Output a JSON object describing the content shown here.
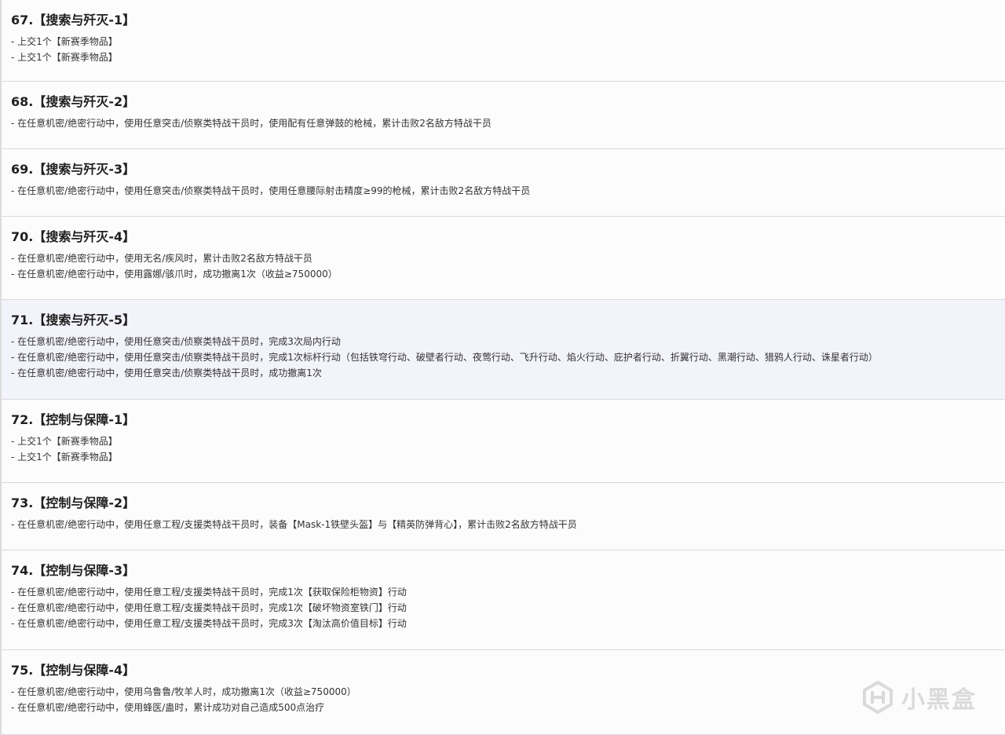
{
  "tasks": [
    {
      "title": "67.【搜索与歼灭-1】",
      "lines": [
        "- 上交1个【新赛季物品】",
        "- 上交1个【新赛季物品】"
      ]
    },
    {
      "title": "68.【搜索与歼灭-2】",
      "lines": [
        "- 在任意机密/绝密行动中，使用任意突击/侦察类特战干员时，使用配有任意弹鼓的枪械，累计击败2名敌方特战干员"
      ]
    },
    {
      "title": "69.【搜索与歼灭-3】",
      "lines": [
        "- 在任意机密/绝密行动中，使用任意突击/侦察类特战干员时，使用任意腰际射击精度≥99的枪械，累计击败2名敌方特战干员"
      ]
    },
    {
      "title": "70.【搜索与歼灭-4】",
      "lines": [
        "- 在任意机密/绝密行动中，使用无名/疾风时，累计击败2名敌方特战干员",
        "- 在任意机密/绝密行动中，使用露娜/骇爪时，成功撤离1次（收益≥750000）"
      ]
    },
    {
      "title": "71.【搜索与歼灭-5】",
      "highlight": true,
      "lines": [
        "- 在任意机密/绝密行动中，使用任意突击/侦察类特战干员时，完成3次局内行动",
        "- 在任意机密/绝密行动中，使用任意突击/侦察类特战干员时，完成1次标杆行动（包括铁穹行动、破壁者行动、夜莺行动、飞升行动、焰火行动、庇护者行动、折翼行动、黑潮行动、猎鸦人行动、诛星者行动）",
        "- 在任意机密/绝密行动中，使用任意突击/侦察类特战干员时，成功撤离1次"
      ]
    },
    {
      "title": "72.【控制与保障-1】",
      "lines": [
        "- 上交1个【新赛季物品】",
        "- 上交1个【新赛季物品】"
      ]
    },
    {
      "title": "73.【控制与保障-2】",
      "lines": [
        "- 在任意机密/绝密行动中，使用任意工程/支援类特战干员时，装备【Mask-1铁壁头盔】与【精英防弹背心】，累计击败2名敌方特战干员"
      ]
    },
    {
      "title": "74.【控制与保障-3】",
      "lines": [
        "- 在任意机密/绝密行动中，使用任意工程/支援类特战干员时，完成1次【获取保险柜物资】行动",
        "- 在任意机密/绝密行动中，使用任意工程/支援类特战干员时，完成1次【破坏物资室铁门】行动",
        "- 在任意机密/绝密行动中，使用任意工程/支援类特战干员时，完成3次【淘汰高价值目标】行动"
      ]
    },
    {
      "title": "75.【控制与保障-4】",
      "lines": [
        "- 在任意机密/绝密行动中，使用乌鲁鲁/牧羊人时，成功撤离1次（收益≥750000）",
        "- 在任意机密/绝密行动中，使用蜂医/蛊时，累计成功对自己造成500点治疗"
      ]
    }
  ],
  "watermark": {
    "text": "小黑盒",
    "icon": "heybox-logo-icon",
    "color": "#bfbfbf"
  },
  "colors": {
    "highlight_bg": "#f2f3fb",
    "row_bg": "#fcfcfc",
    "divider": "#d9d9d9"
  }
}
